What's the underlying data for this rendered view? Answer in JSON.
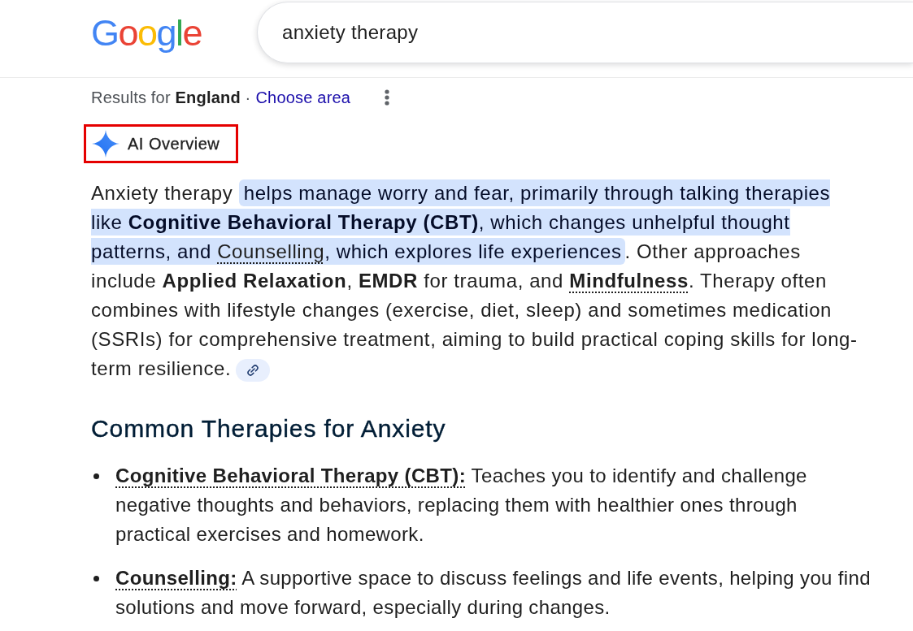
{
  "header": {
    "logo": "Google",
    "search": {
      "value": "anxiety therapy"
    }
  },
  "location_bar": {
    "text": "Results for **England** ·",
    "link": "Choose area"
  },
  "ai_overview": {
    "title": "AI Overview",
    "outlined": true,
    "summary": [
      {
        "text": "Anxiety therapy ",
        "highlighted": false,
        "linked": false
      },
      {
        "text": "helps manage worry and fear, primarily through talking therapies like **Cognitive Behavioral Therapy (CBT)**, which changes unhelpful thought patterns, and ",
        "highlighted": true,
        "linked": false
      },
      {
        "text": "Counselling",
        "highlighted": true,
        "linked": true
      },
      {
        "text": ", which explores life experiences",
        "highlighted": true,
        "linked": false
      },
      {
        "text": ". Other approaches include **Applied Relaxation**, **EMDR** for trauma, and ",
        "highlighted": false,
        "linked": false
      },
      {
        "text": "**Mindfulness**",
        "highlighted": false,
        "linked": true
      },
      {
        "text": ". Therapy often combines with lifestyle changes (exercise, diet, sleep) and sometimes medication (SSRIs) for comprehensive treatment, aiming to build practical coping skills for long-term resilience.",
        "highlighted": false,
        "linked": false
      }
    ],
    "section": {
      "heading": "Common Therapies for Anxiety",
      "items": [
        {
          "term": "Cognitive Behavioral Therapy (CBT):",
          "description": "Teaches you to identify and challenge negative thoughts and behaviors, replacing them with healthier ones through practical exercises and homework."
        },
        {
          "term": "Counselling:",
          "description": "A supportive space to discuss feelings and life events, helping you find solutions and move forward, especially during changes."
        }
      ]
    }
  }
}
